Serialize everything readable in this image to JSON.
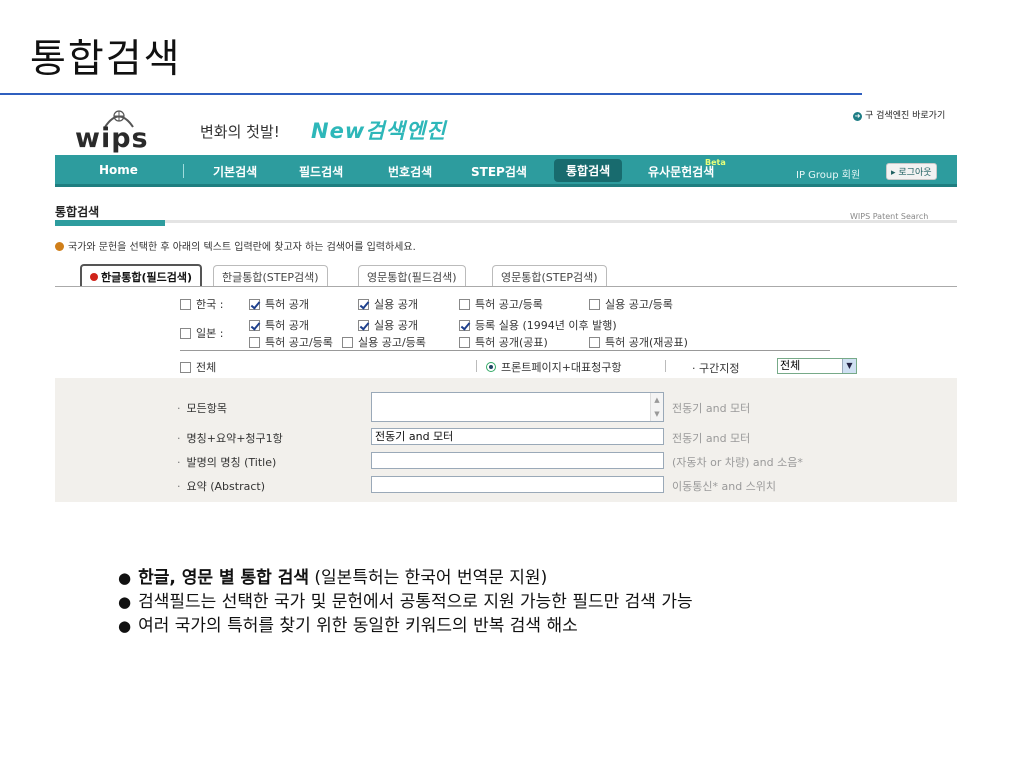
{
  "slide": {
    "title": "통합검색",
    "bullets": [
      {
        "bold": "한글, 영문 별 통합 검색",
        "rest": " (일본특허는 한국어 번역문 지원)"
      },
      {
        "bold": "",
        "rest": "검색필드는 선택한 국가 및 문헌에서 공통적으로 지원 가능한 필드만 검색 가능"
      },
      {
        "bold": "",
        "rest": "여러 국가의 특허를 찾기 위한 동일한 키워드의 반복 검색 해소"
      }
    ]
  },
  "header": {
    "logo": "wips",
    "slogan": "변화의 첫발!",
    "slogan_highlight": "New검색엔진",
    "old_engine_link": "구 검색엔진 바로가기"
  },
  "nav": {
    "items": [
      "Home",
      "기본검색",
      "필드검색",
      "번호검색",
      "STEP검색",
      "통합검색",
      "유사문헌검색"
    ],
    "beta": "Beta",
    "ip_group": "IP Group 회원",
    "logout": "로그아웃"
  },
  "section": {
    "title": "통합검색",
    "subtitle": "WIPS Patent Search",
    "instruction": "국가와 문헌을 선택한 후 아래의 텍스트 입력란에 찾고자 하는 검색어를 입력하세요."
  },
  "tabs": [
    "한글통합(필드검색)",
    "한글통합(STEP검색)",
    "영문통합(필드검색)",
    "영문통합(STEP검색)"
  ],
  "countries": {
    "korea_label": "한국 :",
    "japan_label": "일본 :",
    "korea_options": [
      {
        "label": "특허 공개",
        "checked": true
      },
      {
        "label": "실용 공개",
        "checked": true
      },
      {
        "label": "특허 공고/등록",
        "checked": false
      },
      {
        "label": "실용 공고/등록",
        "checked": false
      }
    ],
    "japan_options_row1": [
      {
        "label": "특허 공개",
        "checked": true
      },
      {
        "label": "실용 공개",
        "checked": true
      },
      {
        "label": "등록 실용 (1994년 이후 발행)",
        "checked": true
      }
    ],
    "japan_options_row2": [
      {
        "label": "특허 공고/등록",
        "checked": false
      },
      {
        "label": "실용 공고/등록",
        "checked": false
      },
      {
        "label": "특허 공개(공표)",
        "checked": false
      },
      {
        "label": "특허 공개(재공표)",
        "checked": false
      }
    ],
    "all_label": "전체",
    "front_page": "프론트페이지+대표청구항",
    "range_label": "구간지정",
    "range_value": "전체"
  },
  "fields": [
    {
      "label": "모든항목",
      "value": "",
      "hint": "전동기 and 모터"
    },
    {
      "label": "명칭+요약+청구1항",
      "value": "전동기 and 모터",
      "hint": "전동기 and 모터"
    },
    {
      "label": "발명의 명칭 (Title)",
      "value": "",
      "hint": "(자동차 or 차량) and 소음*"
    },
    {
      "label": "요약 (Abstract)",
      "value": "",
      "hint": "이동통신* and 스위치"
    }
  ],
  "colors": {
    "nav_teal": "#2d9c9e",
    "nav_active": "#186b6e",
    "title_rule": "#2f5fbf",
    "field_bg": "#f2f0ec"
  }
}
